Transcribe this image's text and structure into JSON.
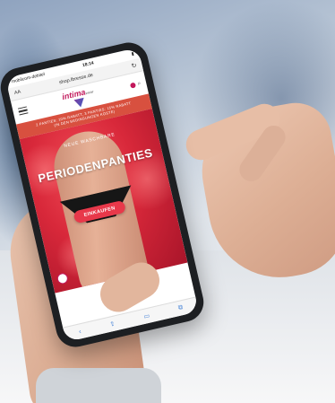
{
  "status_bar": {
    "carrier": "mobilcom-debitel",
    "time": "18:14"
  },
  "browser": {
    "text_size": "AA",
    "url": "shop.lbresse.de",
    "reload_icon": "reload-icon"
  },
  "site": {
    "logo_text": "intima",
    "logo_subtext": "wear",
    "promo_line1": "2 PANTIES: 10% RABATT, 3 PANTIES: 15% RABATT",
    "promo_line2": "(IN DEN BEDINGUNGEN KOSTE)",
    "hero_sub": "NEUE WASCHBARE",
    "hero_title": "PERIODENPANTIES",
    "cta_label": "EINKAUFEN"
  },
  "colors": {
    "accent": "#d8503f",
    "brand": "#c2185b",
    "hero": "#d8283a"
  }
}
